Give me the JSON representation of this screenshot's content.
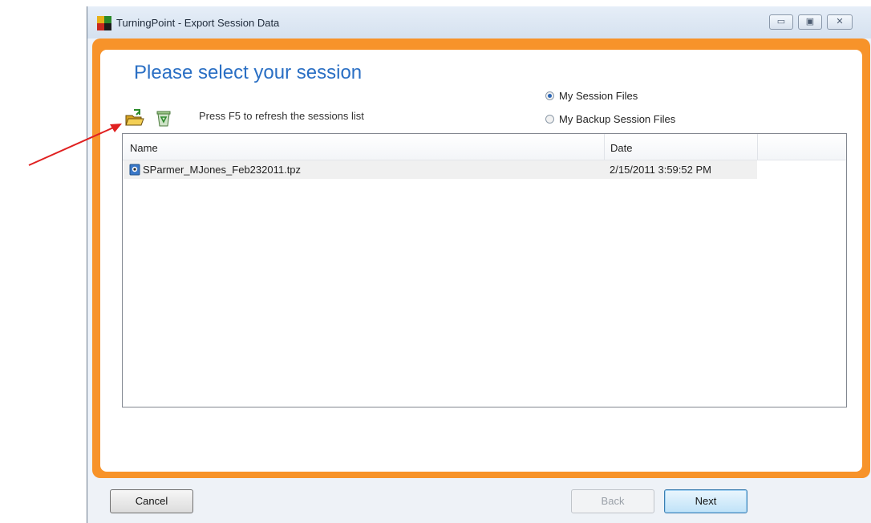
{
  "window": {
    "title": "TurningPoint - Export Session Data",
    "controls": {
      "minimize": "▭",
      "maximize": "▣",
      "close": "✕"
    }
  },
  "main": {
    "heading": "Please select your session",
    "refresh_hint": "Press F5 to refresh the sessions list",
    "icons": {
      "open": "open-folder-icon",
      "recycle": "recycle-bin-icon"
    },
    "source_options": [
      {
        "label": "My Session Files",
        "selected": true
      },
      {
        "label": "My Backup Session Files",
        "selected": false
      }
    ]
  },
  "sessions": {
    "columns": {
      "name": "Name",
      "date": "Date"
    },
    "rows": [
      {
        "name": "SParmer_MJones_Feb232011.tpz",
        "date": "2/15/2011 3:59:52 PM"
      }
    ]
  },
  "buttons": {
    "cancel": "Cancel",
    "back": "Back",
    "next": "Next"
  },
  "colors": {
    "frame": "#f7932a",
    "heading": "#2a6fc4",
    "annotation_arrow": "#e02020"
  }
}
